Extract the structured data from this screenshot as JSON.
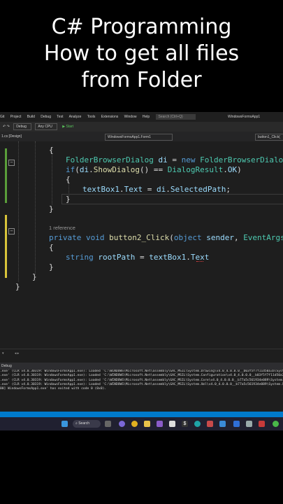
{
  "title": {
    "line1": "C# Programming",
    "line2": "How to get all files",
    "line3": "from Folder"
  },
  "menu": {
    "items": [
      "Git",
      "Project",
      "Build",
      "Debug",
      "Test",
      "Analyze",
      "Tools",
      "Extensions",
      "Window",
      "Help"
    ],
    "search_placeholder": "Search (Ctrl+Q)",
    "app_name": "WindowsFormsApp1"
  },
  "toolbar": {
    "config": "Debug",
    "platform": "Any CPU",
    "start_label": "▶ Start"
  },
  "tabs": {
    "file_tab": "1.cs [Design]",
    "nav_left": "WindowsFormsApp1.Form1",
    "nav_right": "button1_Click("
  },
  "code": {
    "line1": "{",
    "line2_t1": "FolderBrowserDialog",
    "line2_t2": " di",
    "line2_t3": " = ",
    "line2_t4": "new",
    "line2_t5": " FolderBrowserDialog",
    "line2_t6": "();",
    "line3_t1": "if",
    "line3_t2": "(",
    "line3_t3": "di",
    "line3_t4": ".",
    "line3_t5": "ShowDialog",
    "line3_t6": "() == ",
    "line3_t7": "DialogResult",
    "line3_t8": ".",
    "line3_t9": "OK",
    "line3_t10": ")",
    "line4": "{",
    "line5_t1": "textBox1",
    "line5_t2": ".",
    "line5_t3": "Text",
    "line5_t4": " = ",
    "line5_t5": "di",
    "line5_t6": ".",
    "line5_t7": "SelectedPath",
    "line5_t8": ";",
    "line6": "}",
    "line7": "}",
    "references": "1 reference",
    "line8_t1": "private",
    "line8_t2": " void",
    "line8_t3": " button2_Click",
    "line8_t4": "(",
    "line8_t5": "object",
    "line8_t6": " sender",
    "line8_t7": ", ",
    "line8_t8": "EventArgs",
    "line8_t9": " e)",
    "line9": "{",
    "line10_t1": "string",
    "line10_t2": " rootPath",
    "line10_t3": " = ",
    "line10_t4": "textBox1",
    "line10_t5": ".",
    "line10_t6": "Text",
    "line11": "}",
    "line12": "}",
    "line13": "}"
  },
  "output": {
    "title": "Debug",
    "lines": [
      ".exe' (CLR v4.0.30319: WindowsFormsApp1.exe): Loaded 'C:\\WINDOWS\\Microsoft.Net\\assembly\\GAC_MSIL\\System.Drawing\\v4.0_4.0.0.0__b03f5f7f11d50a3a\\System.Drawing.dll'.",
      ".exe' (CLR v4.0.30319: WindowsFormsApp1.exe): Loaded 'C:\\WINDOWS\\Microsoft.Net\\assembly\\GAC_MSIL\\System.Configuration\\v4.0_4.0.0.0__b03f5f7f11d50a3a\\System.Configuration.dll'.",
      ".exe' (CLR v4.0.30319: WindowsFormsApp1.exe): Loaded 'C:\\WINDOWS\\Microsoft.Net\\assembly\\GAC_MSIL\\System.Core\\v4.0_4.0.0.0__b77a5c561934e089\\System.Core.dll'.",
      ".exe' (CLR v4.0.30319: WindowsFormsApp1.exe): Loaded 'C:\\WINDOWS\\Microsoft.Net\\assembly\\GAC_MSIL\\System.Xml\\v4.0_4.0.0.0__b77a5c561934e089\\System.Xml.dll'.",
      "00] WindowsFormsApp1.exe' has exited with code 0 (0x0)."
    ]
  },
  "taskbar": {
    "search_label": "Search"
  },
  "colors": {
    "editor_bg": "#1e1e1e",
    "status_blue": "#007acc",
    "change_green": "#5a9e3a",
    "change_yellow": "#d9c43a"
  }
}
